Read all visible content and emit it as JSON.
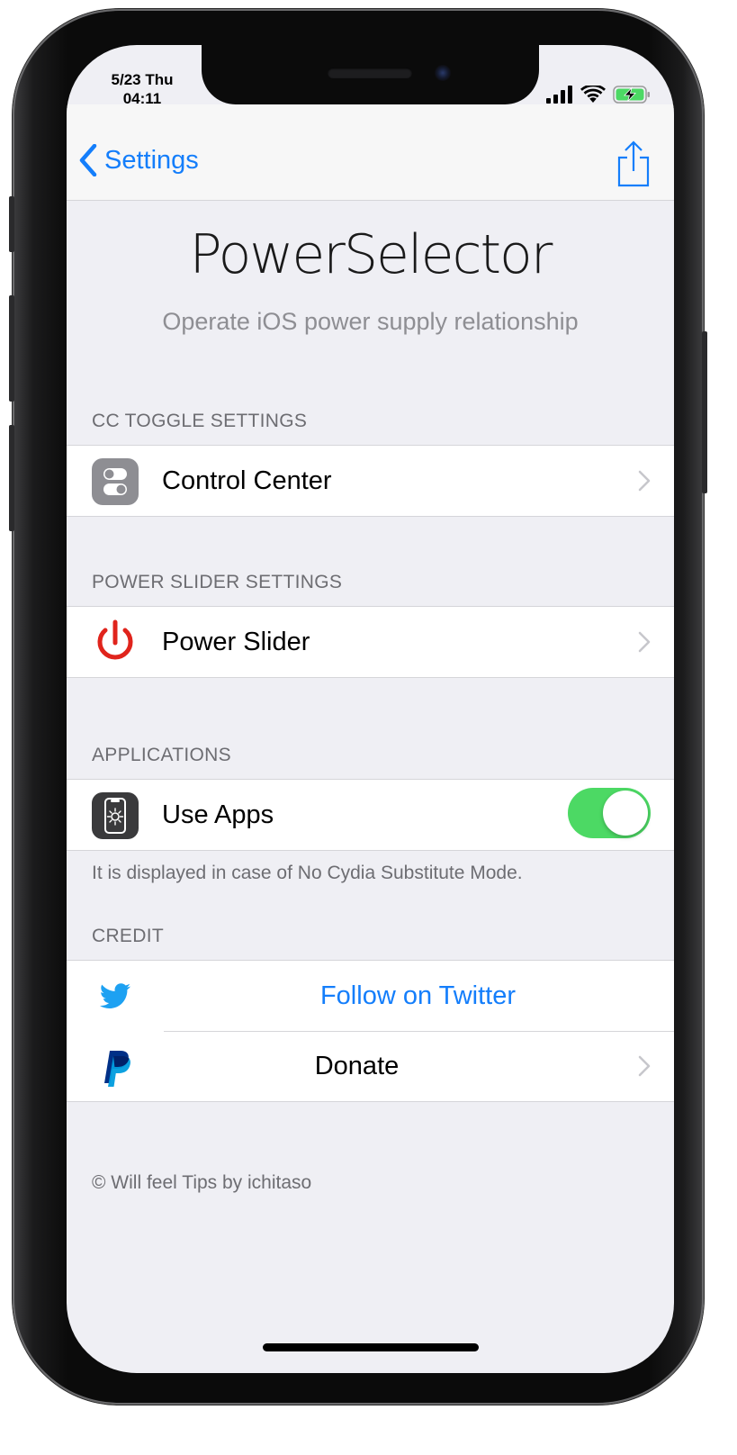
{
  "status_bar": {
    "date": "5/23 Thu",
    "time": "04:11",
    "colors": {
      "battery_fill": "#4cd964"
    }
  },
  "nav": {
    "back_label": "Settings",
    "back_icon": "chevron-left-icon",
    "share_icon": "share-icon",
    "accent_color": "#147efb"
  },
  "header": {
    "title": "PowerSelector",
    "subtitle": "Operate iOS power supply relationship"
  },
  "sections": {
    "cc_toggle": {
      "header": "CC TOGGLE SETTINGS",
      "rows": [
        {
          "label": "Control Center",
          "icon": "control-center-icon"
        }
      ]
    },
    "power_slider": {
      "header": "POWER SLIDER SETTINGS",
      "rows": [
        {
          "label": "Power Slider",
          "icon": "power-icon"
        }
      ]
    },
    "applications": {
      "header": "APPLICATIONS",
      "rows": [
        {
          "label": "Use Apps",
          "icon": "phone-apps-icon",
          "toggle_on": true
        }
      ],
      "footer": "It is displayed in case of No Cydia Substitute Mode."
    },
    "credit": {
      "header": "CREDIT",
      "rows": [
        {
          "label": "Follow on Twitter",
          "icon": "twitter-icon"
        },
        {
          "label": "Donate",
          "icon": "paypal-icon"
        }
      ]
    }
  },
  "copyright": "© Will feel Tips by ichitaso",
  "colors": {
    "background": "#efeff4",
    "toggle_on": "#4cd964",
    "power_red": "#e0241c",
    "link_blue": "#147efb"
  }
}
